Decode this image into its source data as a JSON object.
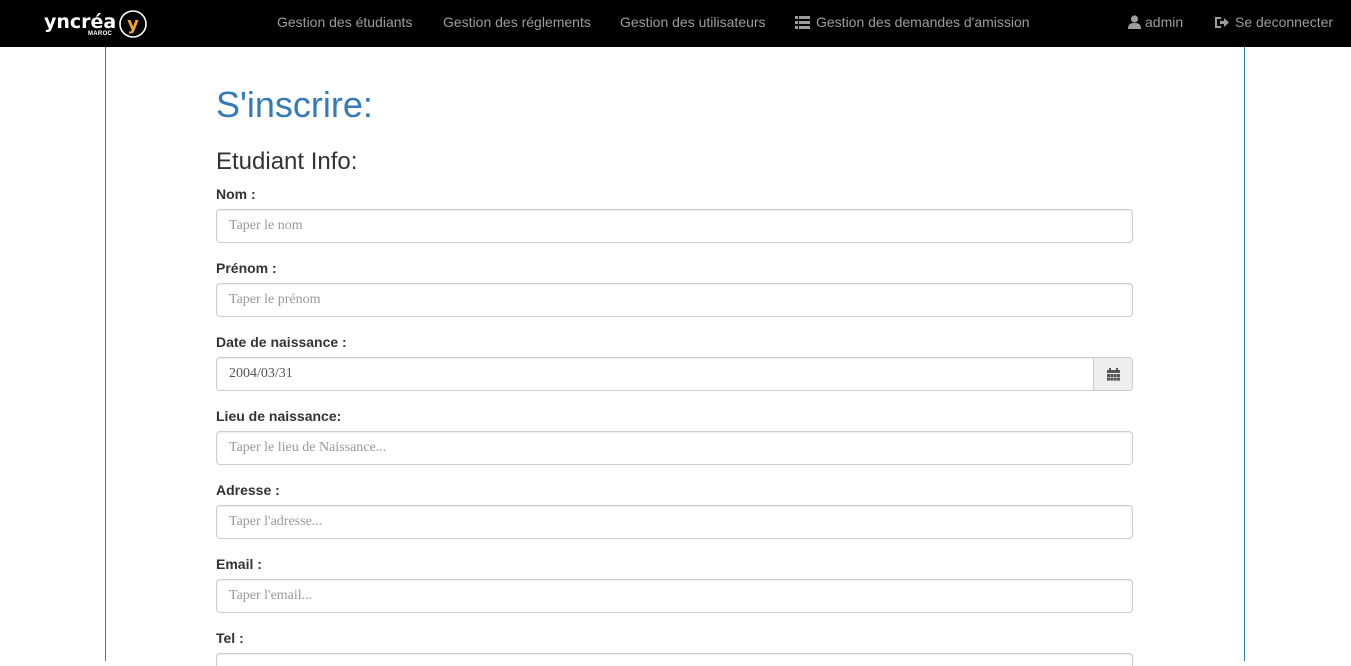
{
  "navbar": {
    "brand": {
      "name": "yncréa",
      "sub": "MAROC",
      "logo_letter": "y"
    },
    "links": [
      {
        "label": "Gestion des étudiants"
      },
      {
        "label": "Gestion des réglements"
      },
      {
        "label": "Gestion des utilisateurs"
      },
      {
        "label": "Gestion des demandes d'amission",
        "icon": "list-icon"
      }
    ],
    "user": {
      "label": "admin",
      "icon": "user-icon"
    },
    "logout": {
      "label": "Se deconnecter",
      "icon": "logout-icon"
    }
  },
  "page": {
    "title": "S'inscrire:",
    "section": "Etudiant Info:"
  },
  "form": {
    "nom": {
      "label": "Nom :",
      "placeholder": "Taper le nom",
      "value": ""
    },
    "prenom": {
      "label": "Prénom :",
      "placeholder": "Taper le prénom",
      "value": ""
    },
    "date_naissance": {
      "label": "Date de naissance :",
      "value": "2004/03/31",
      "icon": "calendar-icon"
    },
    "lieu_naissance": {
      "label": "Lieu de naissance:",
      "placeholder": "Taper le lieu de Naissance...",
      "value": ""
    },
    "adresse": {
      "label": "Adresse :",
      "placeholder": "Taper l'adresse...",
      "value": ""
    },
    "email": {
      "label": "Email :",
      "placeholder": "Taper l'email...",
      "value": ""
    },
    "tel": {
      "label": "Tel :"
    }
  },
  "colors": {
    "navbar_bg": "#000000",
    "nav_text": "#9d9d9d",
    "accent": "#337ab7",
    "logo_accent": "#f5a623"
  }
}
